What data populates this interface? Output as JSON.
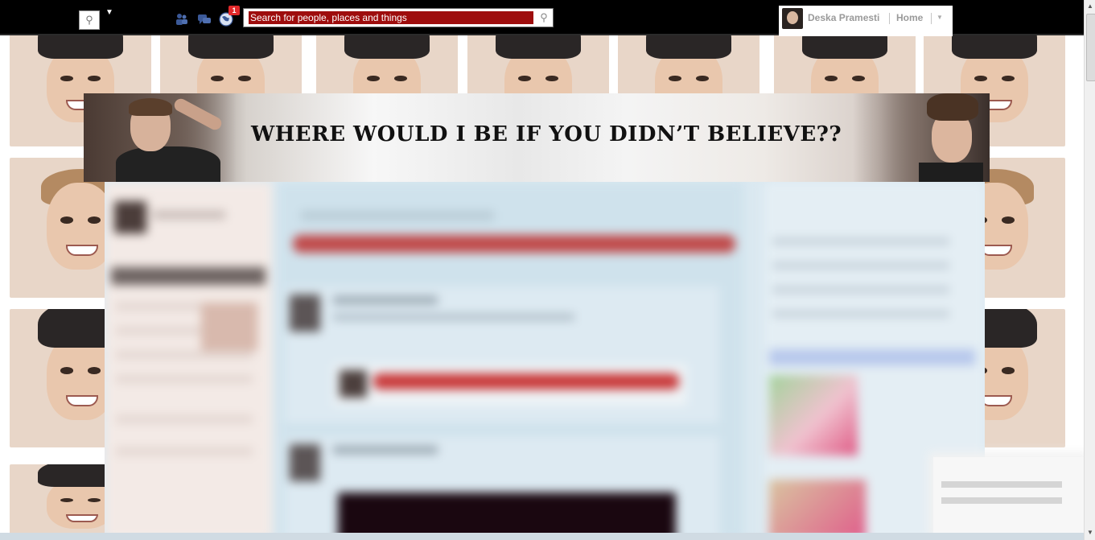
{
  "topbar": {
    "notification_count": "1",
    "search": {
      "placeholder": "Search for people, places and things",
      "value": "Search for people, places and things"
    },
    "user": {
      "name": "Deska Pramesti"
    },
    "nav": {
      "home_label": "Home"
    }
  },
  "banner": {
    "text": "WHERE WOULD I BE IF YOU DIDN’T BELIEVE??"
  },
  "colors": {
    "topbar_bg": "#000000",
    "search_highlight": "#9e0d0d",
    "badge": "#e0282a"
  }
}
